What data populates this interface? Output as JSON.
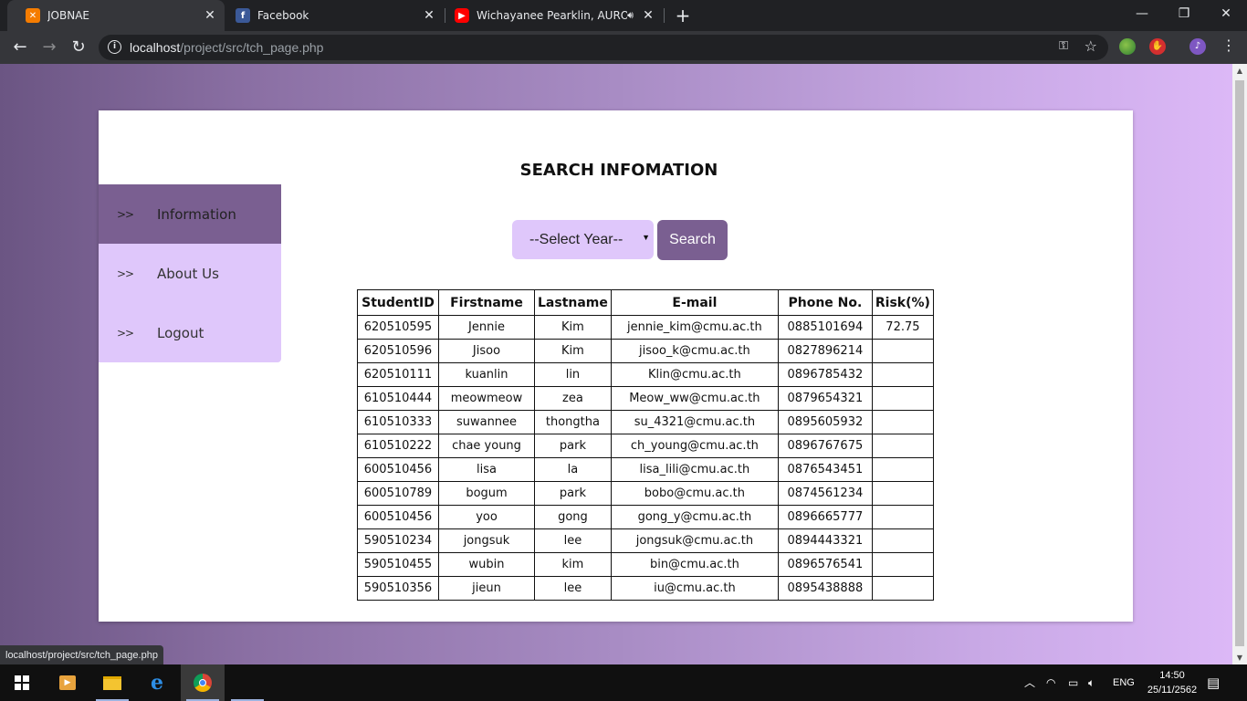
{
  "browser": {
    "tabs": [
      {
        "title": "JOBNAE",
        "favicon": "xampp-icon",
        "active": true
      },
      {
        "title": "Facebook",
        "favicon": "facebook-icon",
        "active": false
      },
      {
        "title": "Wichayanee Pearklin, AURO",
        "favicon": "youtube-icon",
        "active": false,
        "audio": true
      }
    ],
    "url_host": "localhost",
    "url_path": "/project/src/tch_page.php",
    "status_text": "localhost/project/src/tch_page.php"
  },
  "page": {
    "title": "SEARCH INFOMATION",
    "sidebar": [
      {
        "chevron": ">>",
        "label": "Information",
        "active": true
      },
      {
        "chevron": ">>",
        "label": "About Us",
        "active": false
      },
      {
        "chevron": ">>",
        "label": "Logout",
        "active": false
      }
    ],
    "year_select": {
      "value": "--Select Year--"
    },
    "search_button": "Search",
    "table": {
      "headers": [
        "StudentID",
        "Firstname",
        "Lastname",
        "E-mail",
        "Phone No.",
        "Risk(%)"
      ],
      "rows": [
        [
          "620510595",
          "Jennie",
          "Kim",
          "jennie_kim@cmu.ac.th",
          "0885101694",
          "72.75"
        ],
        [
          "620510596",
          "Jisoo",
          "Kim",
          "jisoo_k@cmu.ac.th",
          "0827896214",
          ""
        ],
        [
          "620510111",
          "kuanlin",
          "lin",
          "Klin@cmu.ac.th",
          "0896785432",
          ""
        ],
        [
          "610510444",
          "meowmeow",
          "zea",
          "Meow_ww@cmu.ac.th",
          "0879654321",
          ""
        ],
        [
          "610510333",
          "suwannee",
          "thongtha",
          "su_4321@cmu.ac.th",
          "0895605932",
          ""
        ],
        [
          "610510222",
          "chae young",
          "park",
          "ch_young@cmu.ac.th",
          "0896767675",
          ""
        ],
        [
          "600510456",
          "lisa",
          "la",
          "lisa_lili@cmu.ac.th",
          "0876543451",
          ""
        ],
        [
          "600510789",
          "bogum",
          "park",
          "bobo@cmu.ac.th",
          "0874561234",
          ""
        ],
        [
          "600510456",
          "yoo",
          "gong",
          "gong_y@cmu.ac.th",
          "0896665777",
          ""
        ],
        [
          "590510234",
          "jongsuk",
          "lee",
          "jongsuk@cmu.ac.th",
          "0894443321",
          ""
        ],
        [
          "590510455",
          "wubin",
          "kim",
          "bin@cmu.ac.th",
          "0896576541",
          ""
        ],
        [
          "590510356",
          "jieun",
          "lee",
          "iu@cmu.ac.th",
          "0895438888",
          ""
        ]
      ]
    }
  },
  "taskbar": {
    "language": "ENG",
    "time": "14:50",
    "date": "25/11/2562"
  }
}
